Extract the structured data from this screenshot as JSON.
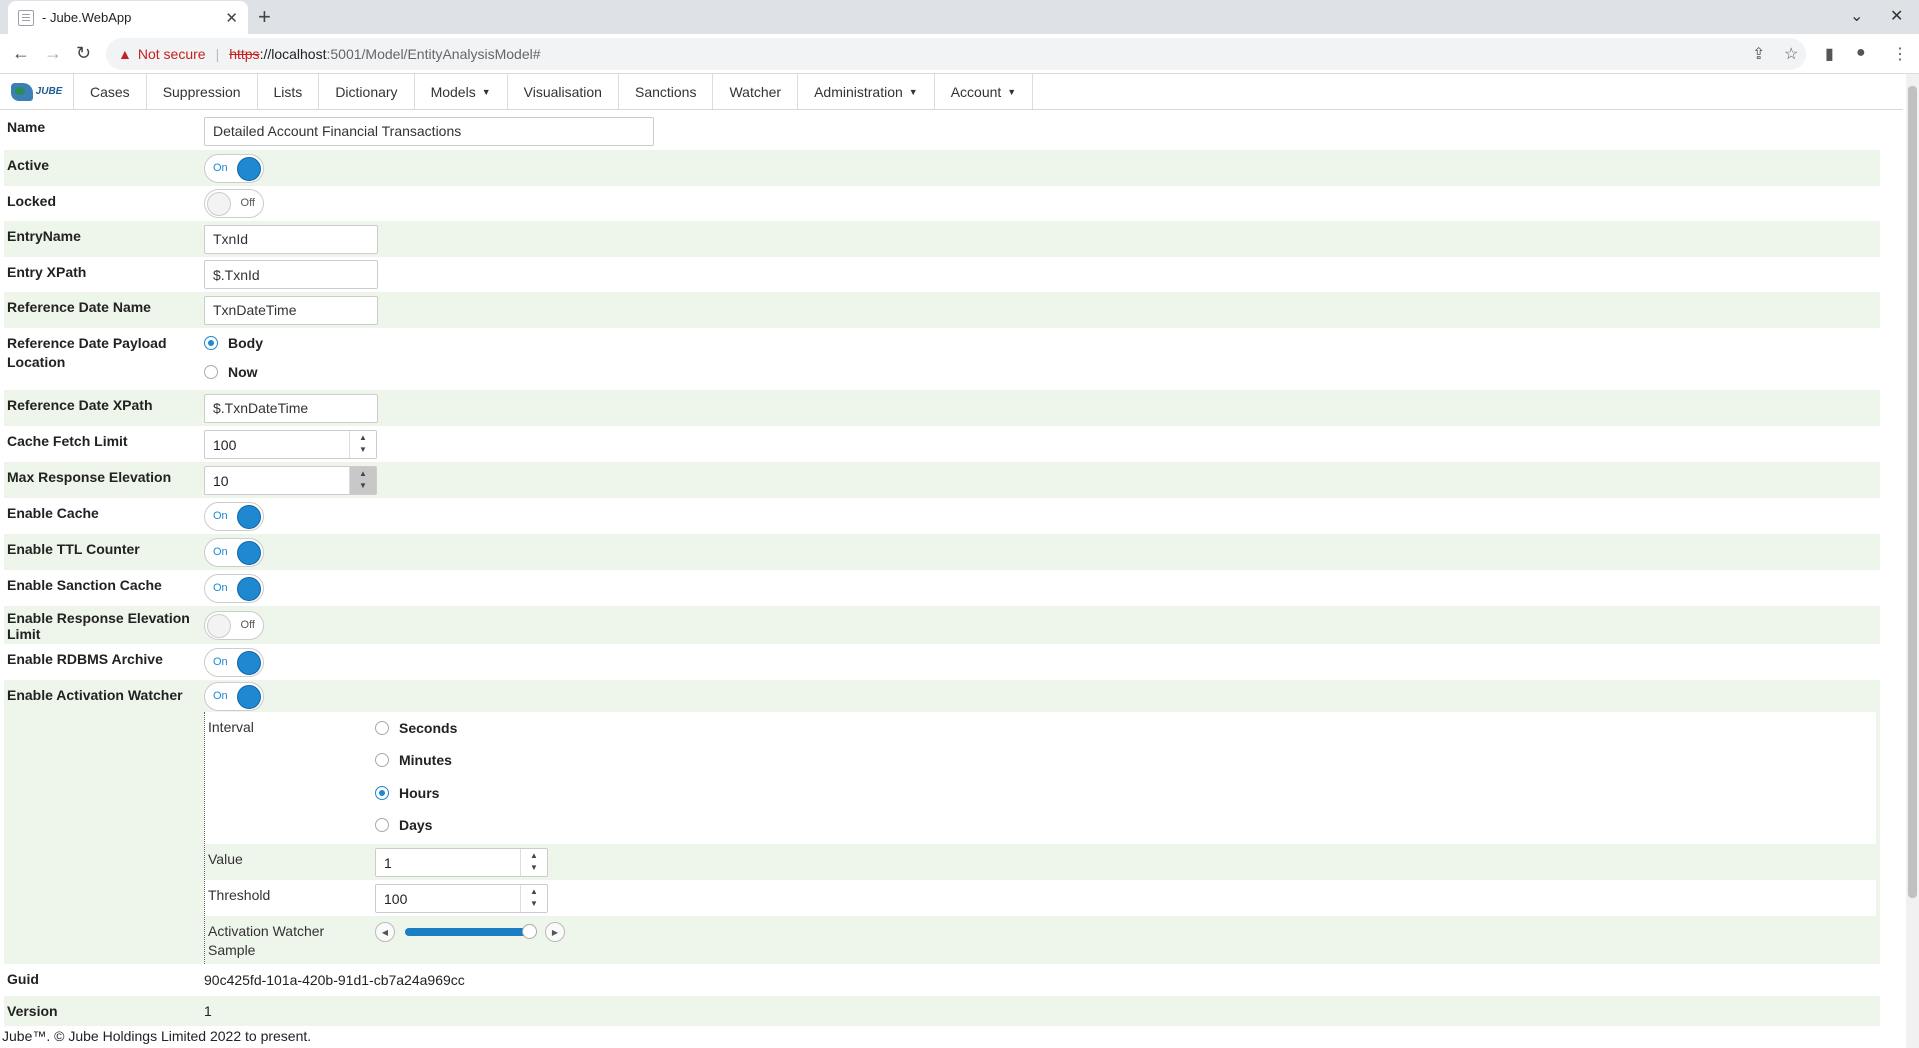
{
  "browser": {
    "tab_title": "- Jube.WebApp",
    "security": "Not secure",
    "url_scheme": "https",
    "url_host": "://localhost",
    "url_path": ":5001/Model/EntityAnalysisModel#"
  },
  "nav": {
    "logo_text": "JUBE",
    "items": [
      {
        "label": "Cases"
      },
      {
        "label": "Suppression"
      },
      {
        "label": "Lists"
      },
      {
        "label": "Dictionary"
      },
      {
        "label": "Models",
        "dropdown": true
      },
      {
        "label": "Visualisation"
      },
      {
        "label": "Sanctions"
      },
      {
        "label": "Watcher"
      },
      {
        "label": "Administration",
        "dropdown": true
      },
      {
        "label": "Account",
        "dropdown": true
      }
    ]
  },
  "form": {
    "name": {
      "label": "Name",
      "value": "Detailed Account Financial Transactions"
    },
    "active": {
      "label": "Active",
      "state": "On"
    },
    "locked": {
      "label": "Locked",
      "state": "Off"
    },
    "entry_name": {
      "label": "EntryName",
      "value": "TxnId"
    },
    "entry_xpath": {
      "label": "Entry XPath",
      "value": "$.TxnId"
    },
    "ref_date_name": {
      "label": "Reference Date Name",
      "value": "TxnDateTime"
    },
    "ref_date_location": {
      "label": "Reference Date Payload Location",
      "options": [
        "Body",
        "Now"
      ],
      "selected": "Body"
    },
    "ref_date_xpath": {
      "label": "Reference Date XPath",
      "value": "$.TxnDateTime"
    },
    "cache_fetch_limit": {
      "label": "Cache Fetch Limit",
      "value": "100"
    },
    "max_response_elevation": {
      "label": "Max Response Elevation",
      "value": "10"
    },
    "enable_cache": {
      "label": "Enable Cache",
      "state": "On"
    },
    "enable_ttl_counter": {
      "label": "Enable TTL Counter",
      "state": "On"
    },
    "enable_sanction_cache": {
      "label": "Enable Sanction Cache",
      "state": "On"
    },
    "enable_response_elevation_limit": {
      "label": "Enable Response Elevation Limit",
      "state": "Off"
    },
    "enable_rdbms_archive": {
      "label": "Enable RDBMS Archive",
      "state": "On"
    },
    "enable_activation_watcher": {
      "label": "Enable Activation Watcher",
      "state": "On"
    },
    "watcher": {
      "interval_label": "Interval",
      "interval_options": [
        "Seconds",
        "Minutes",
        "Hours",
        "Days"
      ],
      "interval_selected": "Hours",
      "value_label": "Value",
      "value": "1",
      "threshold_label": "Threshold",
      "threshold": "100",
      "sample_label": "Activation Watcher Sample",
      "sample_fraction": 0.95
    },
    "guid": {
      "label": "Guid",
      "value": "90c425fd-101a-420b-91d1-cb7a24a969cc"
    },
    "version": {
      "label": "Version",
      "value": "1"
    }
  },
  "footer": "Jube™. © Jube Holdings Limited 2022 to present.",
  "colors": {
    "accent": "#1e88d0",
    "row_alt": "#eef5ea"
  }
}
